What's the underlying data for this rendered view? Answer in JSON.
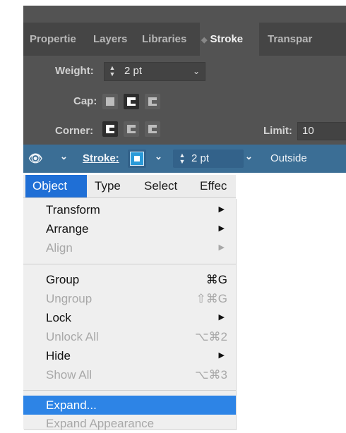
{
  "stroke_panel": {
    "tabs": [
      "Propertie",
      "Layers",
      "Libraries",
      "Stroke",
      "Transpar"
    ],
    "weight_label": "Weight:",
    "weight_value": "2 pt",
    "cap_label": "Cap:",
    "corner_label": "Corner:",
    "limit_label": "Limit:",
    "limit_value": "10"
  },
  "control_bar": {
    "stroke_label": "Stroke:",
    "weight_value": "2 pt",
    "align_value": "Outside"
  },
  "menubar": {
    "items": [
      "Object",
      "Type",
      "Select",
      "Effec"
    ]
  },
  "object_menu": {
    "transform": "Transform",
    "arrange": "Arrange",
    "align": "Align",
    "group": "Group",
    "group_sc": "⌘G",
    "ungroup": "Ungroup",
    "ungroup_sc": "⇧⌘G",
    "lock": "Lock",
    "unlock_all": "Unlock All",
    "unlock_all_sc": "⌥⌘2",
    "hide": "Hide",
    "show_all": "Show All",
    "show_all_sc": "⌥⌘3",
    "expand": "Expand...",
    "expand_appearance": "Expand Appearance"
  },
  "colors": {
    "panel_bg": "#535353",
    "control_bar": "#3b6e95",
    "menu_highlight": "#2d84e6"
  }
}
